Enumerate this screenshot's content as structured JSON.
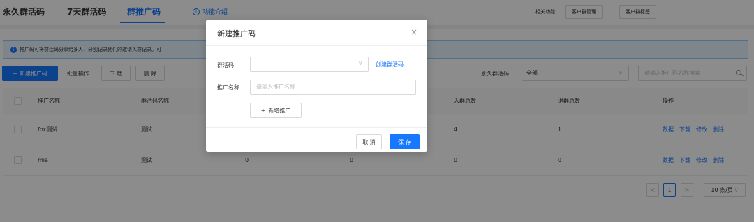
{
  "tabs": [
    {
      "label": "永久群活码"
    },
    {
      "label": "7天群活码"
    },
    {
      "label": "群推广码"
    }
  ],
  "feature_intro": "功能介绍",
  "related": {
    "label": "相关功能:",
    "buttons": [
      "客户群管理",
      "客户群标签"
    ]
  },
  "notice": "推广码可将群活码分享给多人，分别记录他们的邀请入群记录。可",
  "toolbar": {
    "new_button": "新建推广码",
    "batch_label": "批量操作:",
    "download": "下 载",
    "delete": "删 除",
    "filter_label": "永久群活码:",
    "filter_value": "全部",
    "search_placeholder": "请输入推广码名称搜索"
  },
  "table": {
    "headers": [
      "推广名称",
      "群活码名称",
      "入群总数",
      "退群总数",
      "操作"
    ],
    "rows": [
      {
        "name": "fox测试",
        "code_name": "测试",
        "c3": "",
        "c4": "",
        "join": "4",
        "quit": "1"
      },
      {
        "name": "mia",
        "code_name": "测试",
        "c3": "0",
        "c4": "0",
        "join": "0",
        "quit": "0"
      }
    ],
    "actions": [
      "数据",
      "下载",
      "修改",
      "删除"
    ]
  },
  "pagination": {
    "prev": "<",
    "current": "1",
    "next": ">",
    "page_size": "10 条/页"
  },
  "modal": {
    "title": "新建推广码",
    "close": "×",
    "group_code_label": "群活码:",
    "create_link": "创建群活码",
    "promo_name_label": "推广名称:",
    "promo_name_placeholder": "请输入推广名称",
    "add_promo": "新增推广",
    "cancel": "取 消",
    "save": "保 存"
  },
  "colors": {
    "primary": "#1677ff",
    "mask": "rgba(0,0,0,0.45)"
  }
}
